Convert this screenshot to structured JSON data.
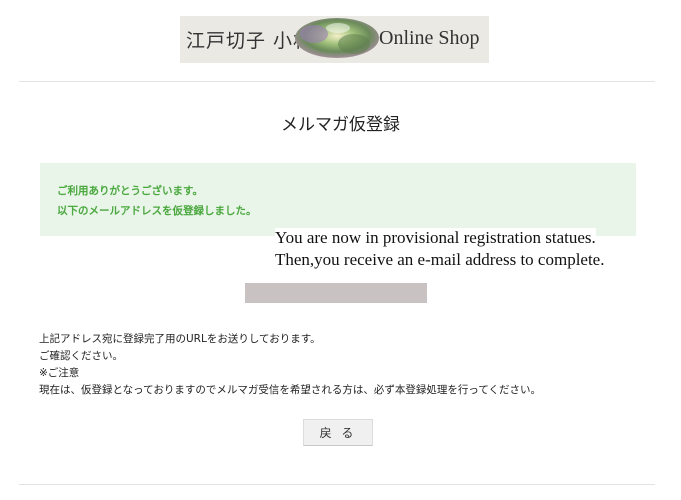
{
  "header": {
    "logo_jp": "江戸切子 小林",
    "logo_en": "Online Shop"
  },
  "page_title": "メルマガ仮登録",
  "notice": {
    "line1": "ご利用ありがとうございます。",
    "line2": "以下のメールアドレスを仮登録しました。"
  },
  "overlay": {
    "line1": "You are now in provisional registration statues.",
    "line2": "Then,you receive an e-mail address to complete."
  },
  "info": {
    "line1": "上記アドレス宛に登録完了用のURLをお送りしております。",
    "line2": "ご確認ください。",
    "line3": "※ご注意",
    "line4": "現在は、仮登録となっておりますのでメルマガ受信を希望される方は、必ず本登録処理を行ってください。"
  },
  "back_button": "戻 る",
  "colors": {
    "notice_bg": "#e8f5e8",
    "notice_text": "#4aa83e",
    "redaction": "#c9c2c2"
  }
}
